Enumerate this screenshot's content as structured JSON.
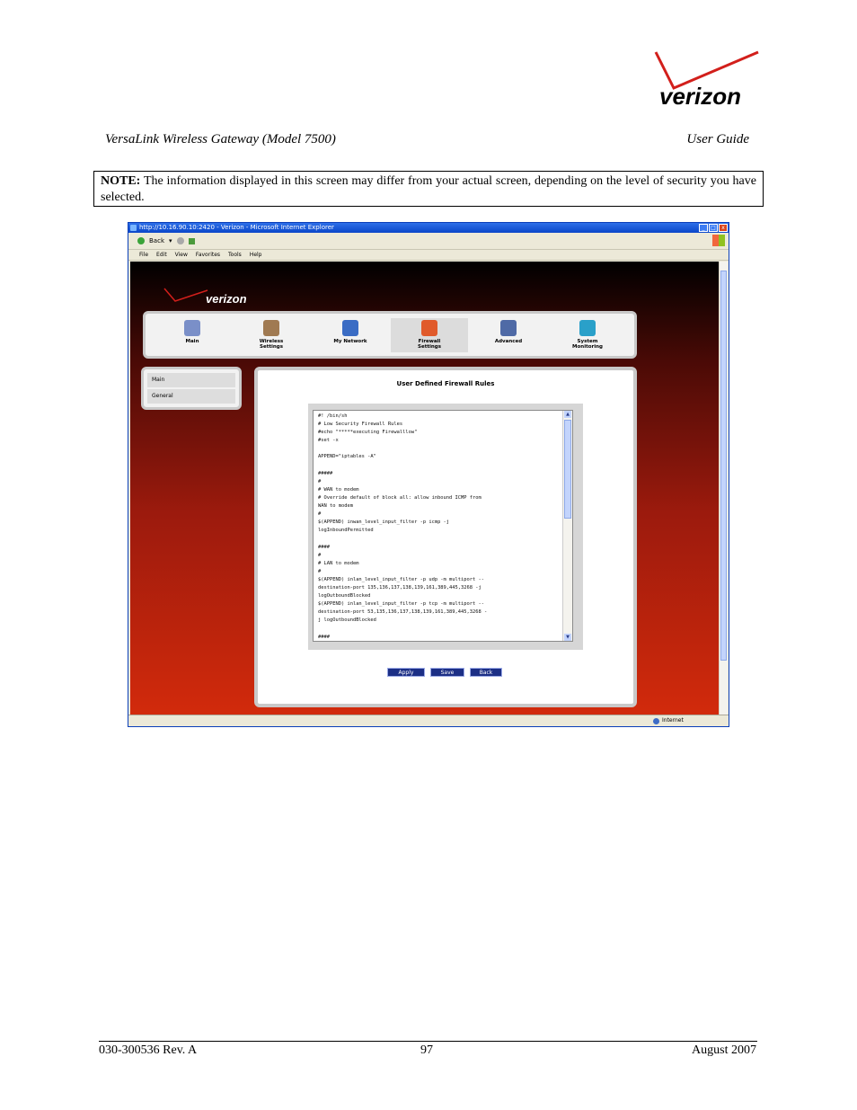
{
  "doc": {
    "brand_logo": "verizon",
    "header_left": "VersaLink Wireless Gateway (Model 7500)",
    "header_right": "User Guide",
    "note_label": "NOTE:",
    "note_text": " The information displayed in this screen may differ from your actual screen, depending on the level of security you have selected.",
    "footer_left": "030-300536 Rev. A",
    "footer_page": "97",
    "footer_date": "August 2007"
  },
  "browser": {
    "title": "http://10.16.90.10:2420 - Verizon - Microsoft Internet Explorer",
    "back_label": "Back",
    "menu": [
      "File",
      "Edit",
      "View",
      "Favorites",
      "Tools",
      "Help"
    ],
    "status_zone": "Internet"
  },
  "app": {
    "nav": [
      {
        "label": "Main",
        "icon": "main-icon",
        "color": "#7a8fc8"
      },
      {
        "label": "Wireless\nSettings",
        "icon": "wireless-icon",
        "color": "#a07a52"
      },
      {
        "label": "My Network",
        "icon": "network-icon",
        "color": "#3a6cc4"
      },
      {
        "label": "Firewall\nSettings",
        "icon": "firewall-icon",
        "color": "#e05a2b"
      },
      {
        "label": "Advanced",
        "icon": "advanced-icon",
        "color": "#4f6aa6"
      },
      {
        "label": "System\nMonitoring",
        "icon": "monitoring-icon",
        "color": "#2aa0c9"
      }
    ],
    "side_menu": [
      "Main",
      "General"
    ],
    "panel_title": "User Defined Firewall Rules",
    "rules_text": "#! /bin/sh\n# Low Security Firewall Rules\n#echo \"*****executing Firewalllow\"\n#set -x\n\nAPPEND=\"iptables -A\"\n\n#####\n#\n# WAN to modem\n# Override default of block all: allow inbound ICMP from\nWAN to modem\n#\n$(APPEND) inwan_level_input_filter -p icmp -j\nlogInboundPermitted\n\n####\n#\n# LAN to modem\n#\n$(APPEND) inlan_level_input_filter -p udp -m multiport --\ndestination-port 135,136,137,138,139,161,389,445,3268 -j\nlogOutboundBlocked\n$(APPEND) inlan_level_input_filter -p tcp -m multiport --\ndestination-port 53,135,136,137,138,139,161,389,445,3268 -\nj logOutboundBlocked\n\n####",
    "buttons": {
      "apply": "Apply",
      "save": "Save",
      "back": "Back"
    }
  }
}
